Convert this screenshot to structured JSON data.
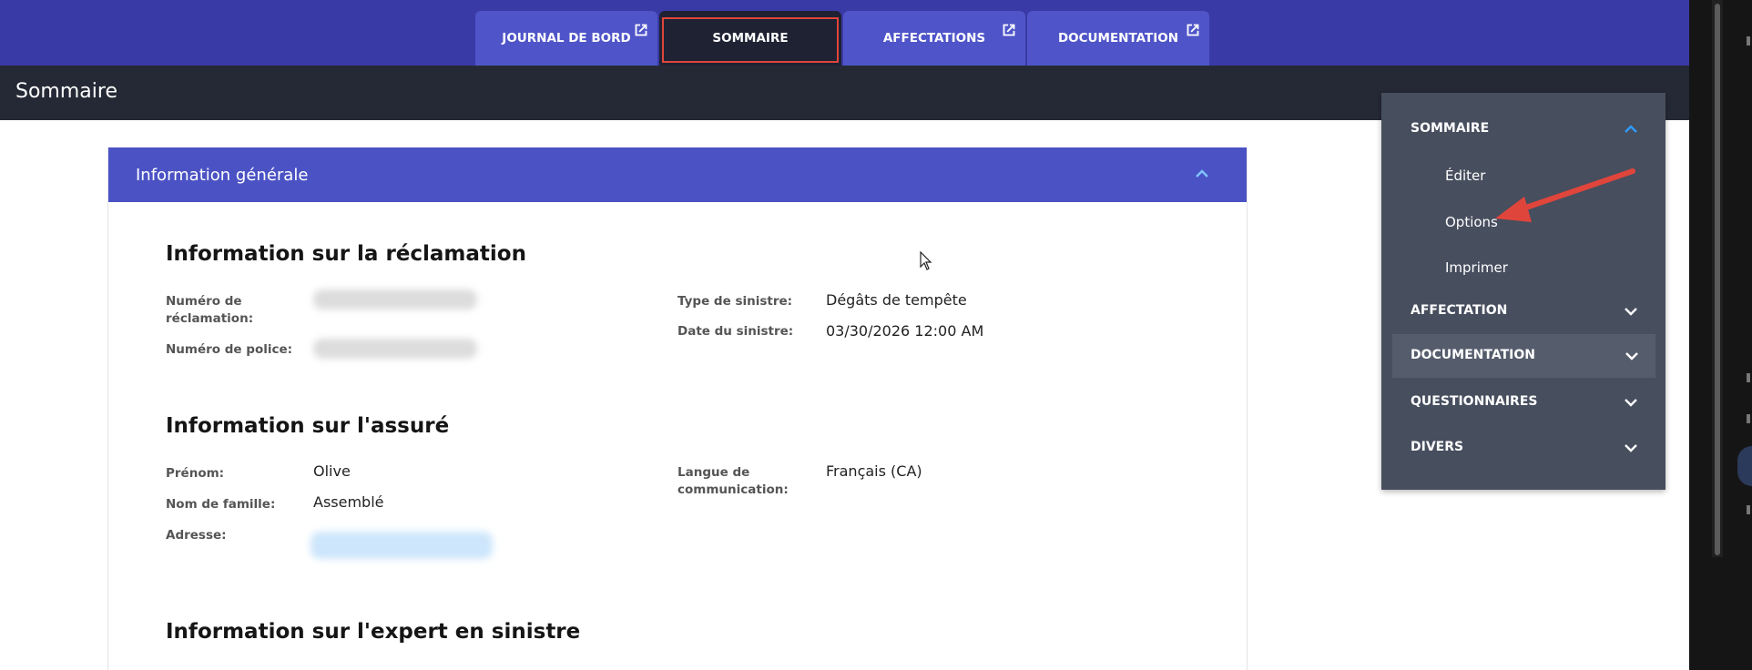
{
  "tabs": [
    {
      "label": "JOURNAL DE BORD",
      "external": true
    },
    {
      "label": "SOMMAIRE",
      "active": true
    },
    {
      "label": "AFFECTATIONS",
      "external": true
    },
    {
      "label": "DOCUMENTATION",
      "external": true
    }
  ],
  "header": {
    "title": "Sommaire"
  },
  "section": {
    "title": "Information générale"
  },
  "claim": {
    "title": "Information sur la réclamation",
    "claim_number_label": "Numéro de réclamation:",
    "policy_number_label": "Numéro de police:",
    "loss_type_label": "Type de sinistre:",
    "loss_type_value": "Dégâts de tempête",
    "loss_date_label": "Date du sinistre:",
    "loss_date_value": "03/30/2026 12:00 AM"
  },
  "insured": {
    "title": "Information sur l'assuré",
    "first_name_label": "Prénom:",
    "first_name_value": "Olive",
    "last_name_label": "Nom de famille:",
    "last_name_value": "Assemblé",
    "address_label": "Adresse:",
    "language_label": "Langue de communication:",
    "language_value": "Français (CA)"
  },
  "adjuster": {
    "title": "Information sur l'expert en sinistre"
  },
  "menu": {
    "sommaire": "SOMMAIRE",
    "sub_items": [
      "Éditer",
      "Options",
      "Imprimer"
    ],
    "affectation": "AFFECTATION",
    "documentation": "DOCUMENTATION",
    "questionnaires": "QUESTIONNAIRES",
    "divers": "DIVERS"
  },
  "colors": {
    "topbar": "#3a3aa6",
    "tab": "#4f55c8",
    "active_tab": "#1e2233",
    "header": "#252936",
    "section_header": "#4b52c4",
    "menu_bg": "#474e5e",
    "accent_chevron": "#2f9bff",
    "annotation": "#e0453b"
  }
}
